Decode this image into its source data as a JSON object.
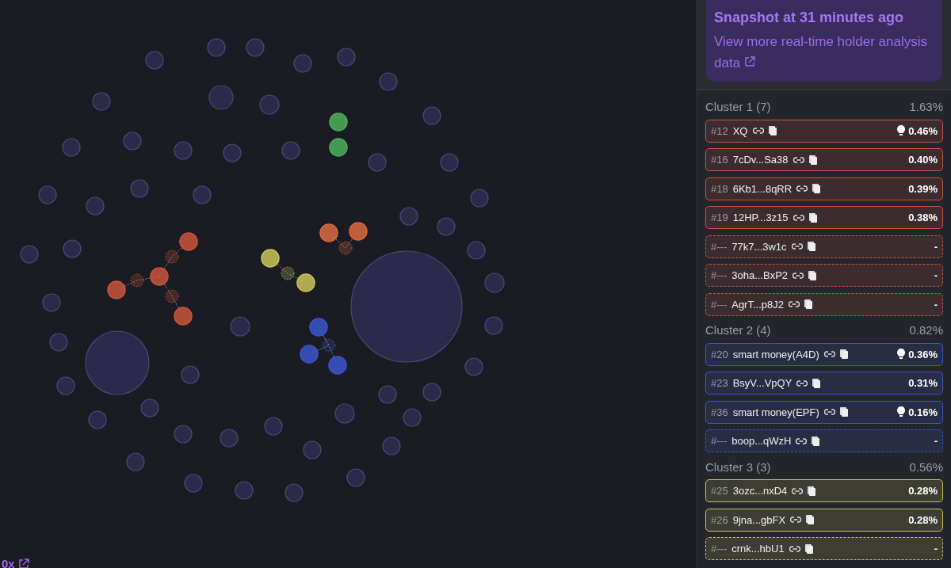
{
  "map": {
    "link": {
      "label": "0x"
    }
  },
  "snapshot": {
    "title": "Snapshot at 31 minutes ago",
    "link": "View more real-time holder analysis data"
  },
  "clusters": [
    {
      "name": "Cluster 1 (7)",
      "share": "1.63%",
      "color": "#c8533a",
      "rows": [
        {
          "kind": "ranked",
          "rank": "#12",
          "name": "XQ",
          "insight": true,
          "share": "0.46%"
        },
        {
          "kind": "ranked",
          "rank": "#16",
          "name": "7cDv...Sa38",
          "insight": false,
          "share": "0.40%"
        },
        {
          "kind": "ranked",
          "rank": "#18",
          "name": "6Kb1...8qRR",
          "insight": false,
          "share": "0.39%"
        },
        {
          "kind": "ranked",
          "rank": "#19",
          "name": "12HP...3z15",
          "insight": false,
          "share": "0.38%"
        },
        {
          "kind": "unranked",
          "rank": "#---",
          "name": "77k7...3w1c",
          "insight": false,
          "share": "-"
        },
        {
          "kind": "unranked",
          "rank": "#---",
          "name": "3oha...BxP2",
          "insight": false,
          "share": "-"
        },
        {
          "kind": "unranked",
          "rank": "#---",
          "name": "AgrT...p8J2",
          "insight": false,
          "share": "-"
        }
      ]
    },
    {
      "name": "Cluster 2 (4)",
      "share": "0.82%",
      "color": "#3a55cc",
      "rows": [
        {
          "kind": "ranked",
          "rank": "#20",
          "name": "smart money(A4D)",
          "insight": true,
          "share": "0.36%"
        },
        {
          "kind": "ranked",
          "rank": "#23",
          "name": "BsyV...VpQY",
          "insight": false,
          "share": "0.31%"
        },
        {
          "kind": "ranked",
          "rank": "#36",
          "name": "smart money(EPF)",
          "insight": true,
          "share": "0.16%"
        },
        {
          "kind": "unranked",
          "rank": "#---",
          "name": "boop...qWzH",
          "insight": false,
          "share": "-"
        }
      ]
    },
    {
      "name": "Cluster 3 (3)",
      "share": "0.56%",
      "color": "#c9c35a",
      "rows": [
        {
          "kind": "ranked",
          "rank": "#25",
          "name": "3ozc...nxD4",
          "insight": false,
          "share": "0.28%"
        },
        {
          "kind": "ranked",
          "rank": "#26",
          "name": "9jna...gbFX",
          "insight": false,
          "share": "0.28%"
        },
        {
          "kind": "unranked",
          "rank": "#---",
          "name": "crnk...hbU1",
          "insight": false,
          "share": "-"
        }
      ]
    }
  ]
}
